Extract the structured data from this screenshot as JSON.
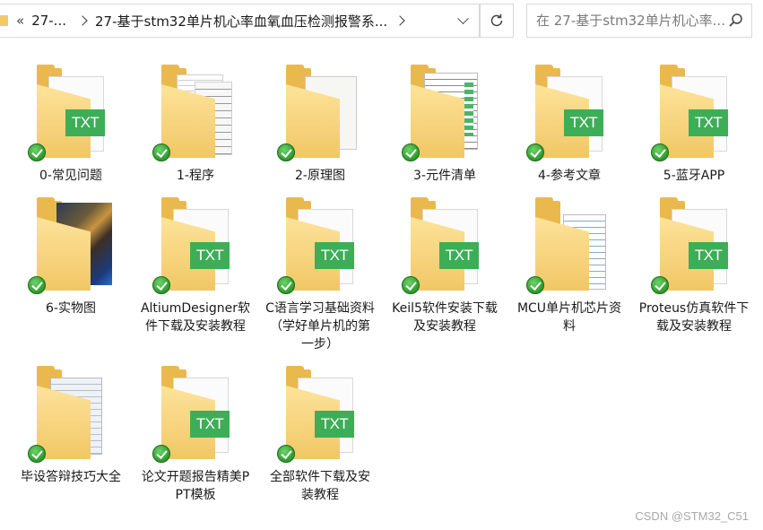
{
  "address_bar": {
    "crumbs": [
      "27-...",
      "27-基于stm32单片机心率血氧血压检测报警系..."
    ]
  },
  "search": {
    "placeholder": "在 27-基于stm32单片机心率..."
  },
  "files": [
    {
      "label": "0-常见问题",
      "thumb": "txt"
    },
    {
      "label": "1-程序",
      "thumb": "doc"
    },
    {
      "label": "2-原理图",
      "thumb": "schematic"
    },
    {
      "label": "3-元件清单",
      "thumb": "bom"
    },
    {
      "label": "4-参考文章",
      "thumb": "txt"
    },
    {
      "label": "5-蓝牙APP",
      "thumb": "txt"
    },
    {
      "label": "6-实物图",
      "thumb": "photo"
    },
    {
      "label": "AltiumDesigner软件下载及安装教程",
      "thumb": "txt"
    },
    {
      "label": "C语言学习基础资料（学好单片机的第一步）",
      "thumb": "txt"
    },
    {
      "label": "Keil5软件安装下载及安装教程",
      "thumb": "txt"
    },
    {
      "label": "MCU单片机芯片资料",
      "thumb": "mcu"
    },
    {
      "label": "Proteus仿真软件下载及安装教程",
      "thumb": "txt"
    },
    {
      "label": "毕设答辩技巧大全",
      "thumb": "word"
    },
    {
      "label": "论文开题报告精美PPT模板",
      "thumb": "txt"
    },
    {
      "label": "全部软件下载及安装教程",
      "thumb": "txt"
    }
  ],
  "badge_text": "TXT",
  "watermark": "CSDN @STM32_C51",
  "colors": {
    "folder": "#f6d27b",
    "txt_badge": "#3dae57",
    "sync_check": "#2e9a2c"
  }
}
